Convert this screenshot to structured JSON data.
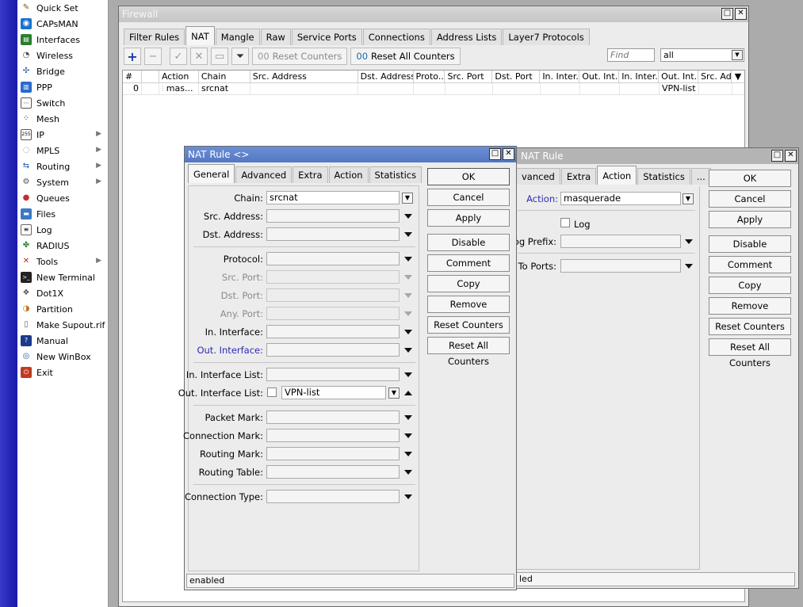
{
  "sidebar": {
    "items": [
      {
        "label": "Quick Set",
        "icon": "wand-icon",
        "has_submenu": false
      },
      {
        "label": "CAPsMAN",
        "icon": "capsman-icon",
        "has_submenu": false
      },
      {
        "label": "Interfaces",
        "icon": "interfaces-icon",
        "has_submenu": false
      },
      {
        "label": "Wireless",
        "icon": "wireless-icon",
        "has_submenu": false
      },
      {
        "label": "Bridge",
        "icon": "bridge-icon",
        "has_submenu": false
      },
      {
        "label": "PPP",
        "icon": "ppp-icon",
        "has_submenu": false
      },
      {
        "label": "Switch",
        "icon": "switch-icon",
        "has_submenu": false
      },
      {
        "label": "Mesh",
        "icon": "mesh-icon",
        "has_submenu": false
      },
      {
        "label": "IP",
        "icon": "ip-icon",
        "has_submenu": true
      },
      {
        "label": "MPLS",
        "icon": "mpls-icon",
        "has_submenu": true
      },
      {
        "label": "Routing",
        "icon": "routing-icon",
        "has_submenu": true
      },
      {
        "label": "System",
        "icon": "system-icon",
        "has_submenu": true
      },
      {
        "label": "Queues",
        "icon": "queues-icon",
        "has_submenu": false
      },
      {
        "label": "Files",
        "icon": "files-icon",
        "has_submenu": false
      },
      {
        "label": "Log",
        "icon": "log-icon",
        "has_submenu": false
      },
      {
        "label": "RADIUS",
        "icon": "radius-icon",
        "has_submenu": false
      },
      {
        "label": "Tools",
        "icon": "tools-icon",
        "has_submenu": true
      },
      {
        "label": "New Terminal",
        "icon": "terminal-icon",
        "has_submenu": false
      },
      {
        "label": "Dot1X",
        "icon": "dot1x-icon",
        "has_submenu": false
      },
      {
        "label": "Partition",
        "icon": "partition-icon",
        "has_submenu": false
      },
      {
        "label": "Make Supout.rif",
        "icon": "supout-icon",
        "has_submenu": false
      },
      {
        "label": "Manual",
        "icon": "manual-icon",
        "has_submenu": false
      },
      {
        "label": "New WinBox",
        "icon": "winbox-icon",
        "has_submenu": false
      },
      {
        "label": "Exit",
        "icon": "exit-icon",
        "has_submenu": false
      }
    ]
  },
  "firewall": {
    "title": "Firewall",
    "tabs": [
      "Filter Rules",
      "NAT",
      "Mangle",
      "Raw",
      "Service Ports",
      "Connections",
      "Address Lists",
      "Layer7 Protocols"
    ],
    "selected_tab": "NAT",
    "toolbar": {
      "reset_counters": "Reset Counters",
      "reset_all_counters": "Reset All Counters",
      "find_placeholder": "Find",
      "filter_value": "all"
    },
    "columns": [
      "#",
      "",
      "Action",
      "Chain",
      "Src. Address",
      "Dst. Address",
      "Proto...",
      "Src. Port",
      "Dst. Port",
      "In. Inter...",
      "Out. Int...",
      "In. Inter...",
      "Out. Int...",
      "Src. Ad..."
    ],
    "rows": [
      {
        "num": "0",
        "action": "mas...",
        "chain": "srcnat",
        "out_interface_list": "VPN-list"
      }
    ]
  },
  "nat_rule_dialog": {
    "title": "NAT Rule <>",
    "tabs": [
      "General",
      "Advanced",
      "Extra",
      "Action",
      "Statistics"
    ],
    "selected_tab": "General",
    "fields": {
      "chain_label": "Chain:",
      "chain_value": "srcnat",
      "src_address_label": "Src. Address:",
      "dst_address_label": "Dst. Address:",
      "protocol_label": "Protocol:",
      "src_port_label": "Src. Port:",
      "dst_port_label": "Dst. Port:",
      "any_port_label": "Any. Port:",
      "in_interface_label": "In. Interface:",
      "out_interface_label": "Out. Interface:",
      "in_interface_list_label": "In. Interface List:",
      "out_interface_list_label": "Out. Interface List:",
      "out_interface_list_value": "VPN-list",
      "packet_mark_label": "Packet Mark:",
      "connection_mark_label": "Connection Mark:",
      "routing_mark_label": "Routing Mark:",
      "routing_table_label": "Routing Table:",
      "connection_type_label": "Connection Type:"
    },
    "buttons": [
      "OK",
      "Cancel",
      "Apply",
      "Disable",
      "Comment",
      "Copy",
      "Remove",
      "Reset Counters",
      "Reset All Counters"
    ],
    "status": "enabled"
  },
  "nat_rule_dialog_2": {
    "title": "NAT Rule",
    "tabs": [
      "vanced",
      "Extra",
      "Action",
      "Statistics",
      "..."
    ],
    "selected_tab": "Action",
    "fields": {
      "action_label": "Action:",
      "action_value": "masquerade",
      "log_label": "Log",
      "log_prefix_label": "Log Prefix:",
      "to_ports_label": "To Ports:"
    },
    "buttons": [
      "OK",
      "Cancel",
      "Apply",
      "Disable",
      "Comment",
      "Copy",
      "Remove",
      "Reset Counters",
      "Reset All Counters"
    ],
    "status": "led"
  }
}
